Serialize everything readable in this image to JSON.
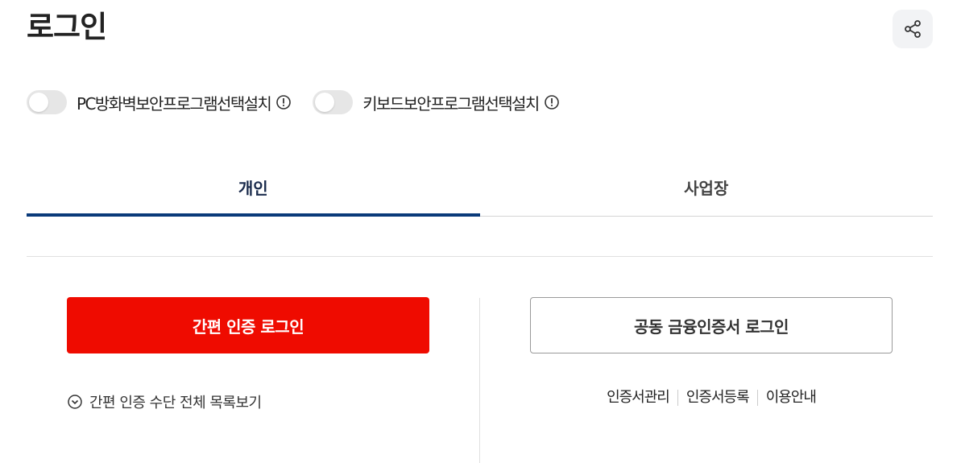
{
  "page": {
    "title": "로그인"
  },
  "toggles": [
    {
      "label": "PC방화벽보안프로그램선택설치",
      "on": false
    },
    {
      "label": "키보드보안프로그램선택설치",
      "on": false
    }
  ],
  "tabs": [
    {
      "label": "개인",
      "active": true
    },
    {
      "label": "사업장",
      "active": false
    }
  ],
  "buttons": {
    "simple_login": "간편 인증 로그인",
    "cert_login": "공동 금융인증서 로그인"
  },
  "more_link": "간편 인증 수단 전체 목록보기",
  "cert_links": [
    "인증서관리",
    "인증서등록",
    "이용안내"
  ],
  "colors": {
    "primary_red": "#ef0b00",
    "tab_active": "#0a3a7a"
  },
  "icons": {
    "share": "share-icon",
    "info": "info-icon",
    "chevron": "chevron-down-circle-icon"
  }
}
